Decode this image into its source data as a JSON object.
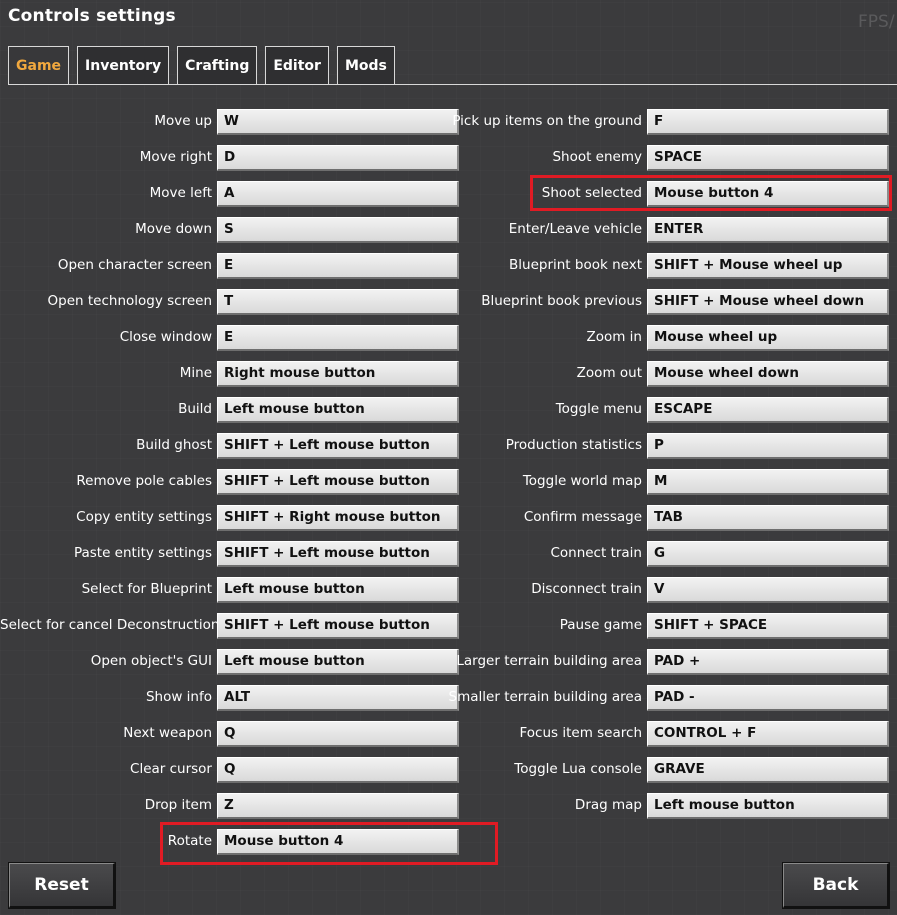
{
  "window": {
    "title": "Controls settings",
    "fps_overlay": "FPS/"
  },
  "tabs": [
    {
      "label": "Game",
      "active": true
    },
    {
      "label": "Inventory",
      "active": false
    },
    {
      "label": "Crafting",
      "active": false
    },
    {
      "label": "Editor",
      "active": false
    },
    {
      "label": "Mods",
      "active": false
    }
  ],
  "controls_left": [
    {
      "action": "Move up",
      "key": "W"
    },
    {
      "action": "Move right",
      "key": "D"
    },
    {
      "action": "Move left",
      "key": "A"
    },
    {
      "action": "Move down",
      "key": "S"
    },
    {
      "action": "Open character screen",
      "key": "E"
    },
    {
      "action": "Open technology screen",
      "key": "T"
    },
    {
      "action": "Close window",
      "key": "E"
    },
    {
      "action": "Mine",
      "key": "Right mouse button"
    },
    {
      "action": "Build",
      "key": "Left mouse button"
    },
    {
      "action": "Build ghost",
      "key": "SHIFT + Left mouse button"
    },
    {
      "action": "Remove pole cables",
      "key": "SHIFT + Left mouse button"
    },
    {
      "action": "Copy entity settings",
      "key": "SHIFT + Right mouse button"
    },
    {
      "action": "Paste entity settings",
      "key": "SHIFT + Left mouse button"
    },
    {
      "action": "Select for Blueprint",
      "key": "Left mouse button"
    },
    {
      "action": "Select for cancel Deconstruction",
      "key": "SHIFT + Left mouse button"
    },
    {
      "action": "Open object's GUI",
      "key": "Left mouse button"
    },
    {
      "action": "Show info",
      "key": "ALT"
    },
    {
      "action": "Next weapon",
      "key": "Q"
    },
    {
      "action": "Clear cursor",
      "key": "Q"
    },
    {
      "action": "Drop item",
      "key": "Z"
    },
    {
      "action": "Rotate",
      "key": "Mouse button 4"
    }
  ],
  "controls_right": [
    {
      "action": "Pick up items on the ground",
      "key": "F"
    },
    {
      "action": "Shoot enemy",
      "key": "SPACE"
    },
    {
      "action": "Shoot selected",
      "key": "Mouse button 4"
    },
    {
      "action": "Enter/Leave vehicle",
      "key": "ENTER"
    },
    {
      "action": "Blueprint book next",
      "key": "SHIFT + Mouse wheel up"
    },
    {
      "action": "Blueprint book previous",
      "key": "SHIFT + Mouse wheel down"
    },
    {
      "action": "Zoom in",
      "key": "Mouse wheel up"
    },
    {
      "action": "Zoom out",
      "key": "Mouse wheel down"
    },
    {
      "action": "Toggle menu",
      "key": "ESCAPE"
    },
    {
      "action": "Production statistics",
      "key": "P"
    },
    {
      "action": "Toggle world map",
      "key": "M"
    },
    {
      "action": "Confirm message",
      "key": "TAB"
    },
    {
      "action": "Connect train",
      "key": "G"
    },
    {
      "action": "Disconnect train",
      "key": "V"
    },
    {
      "action": "Pause game",
      "key": "SHIFT + SPACE"
    },
    {
      "action": "Larger terrain building area",
      "key": "PAD +"
    },
    {
      "action": "Smaller terrain building area",
      "key": "PAD -"
    },
    {
      "action": "Focus item search",
      "key": "CONTROL + F"
    },
    {
      "action": "Toggle Lua console",
      "key": "GRAVE"
    },
    {
      "action": "Drag map",
      "key": "Left mouse button"
    }
  ],
  "footer": {
    "reset_label": "Reset",
    "back_label": "Back"
  },
  "colors": {
    "background": "#3b3b3d",
    "active_tab": "#f1a83e",
    "highlight": "#e01b24"
  }
}
